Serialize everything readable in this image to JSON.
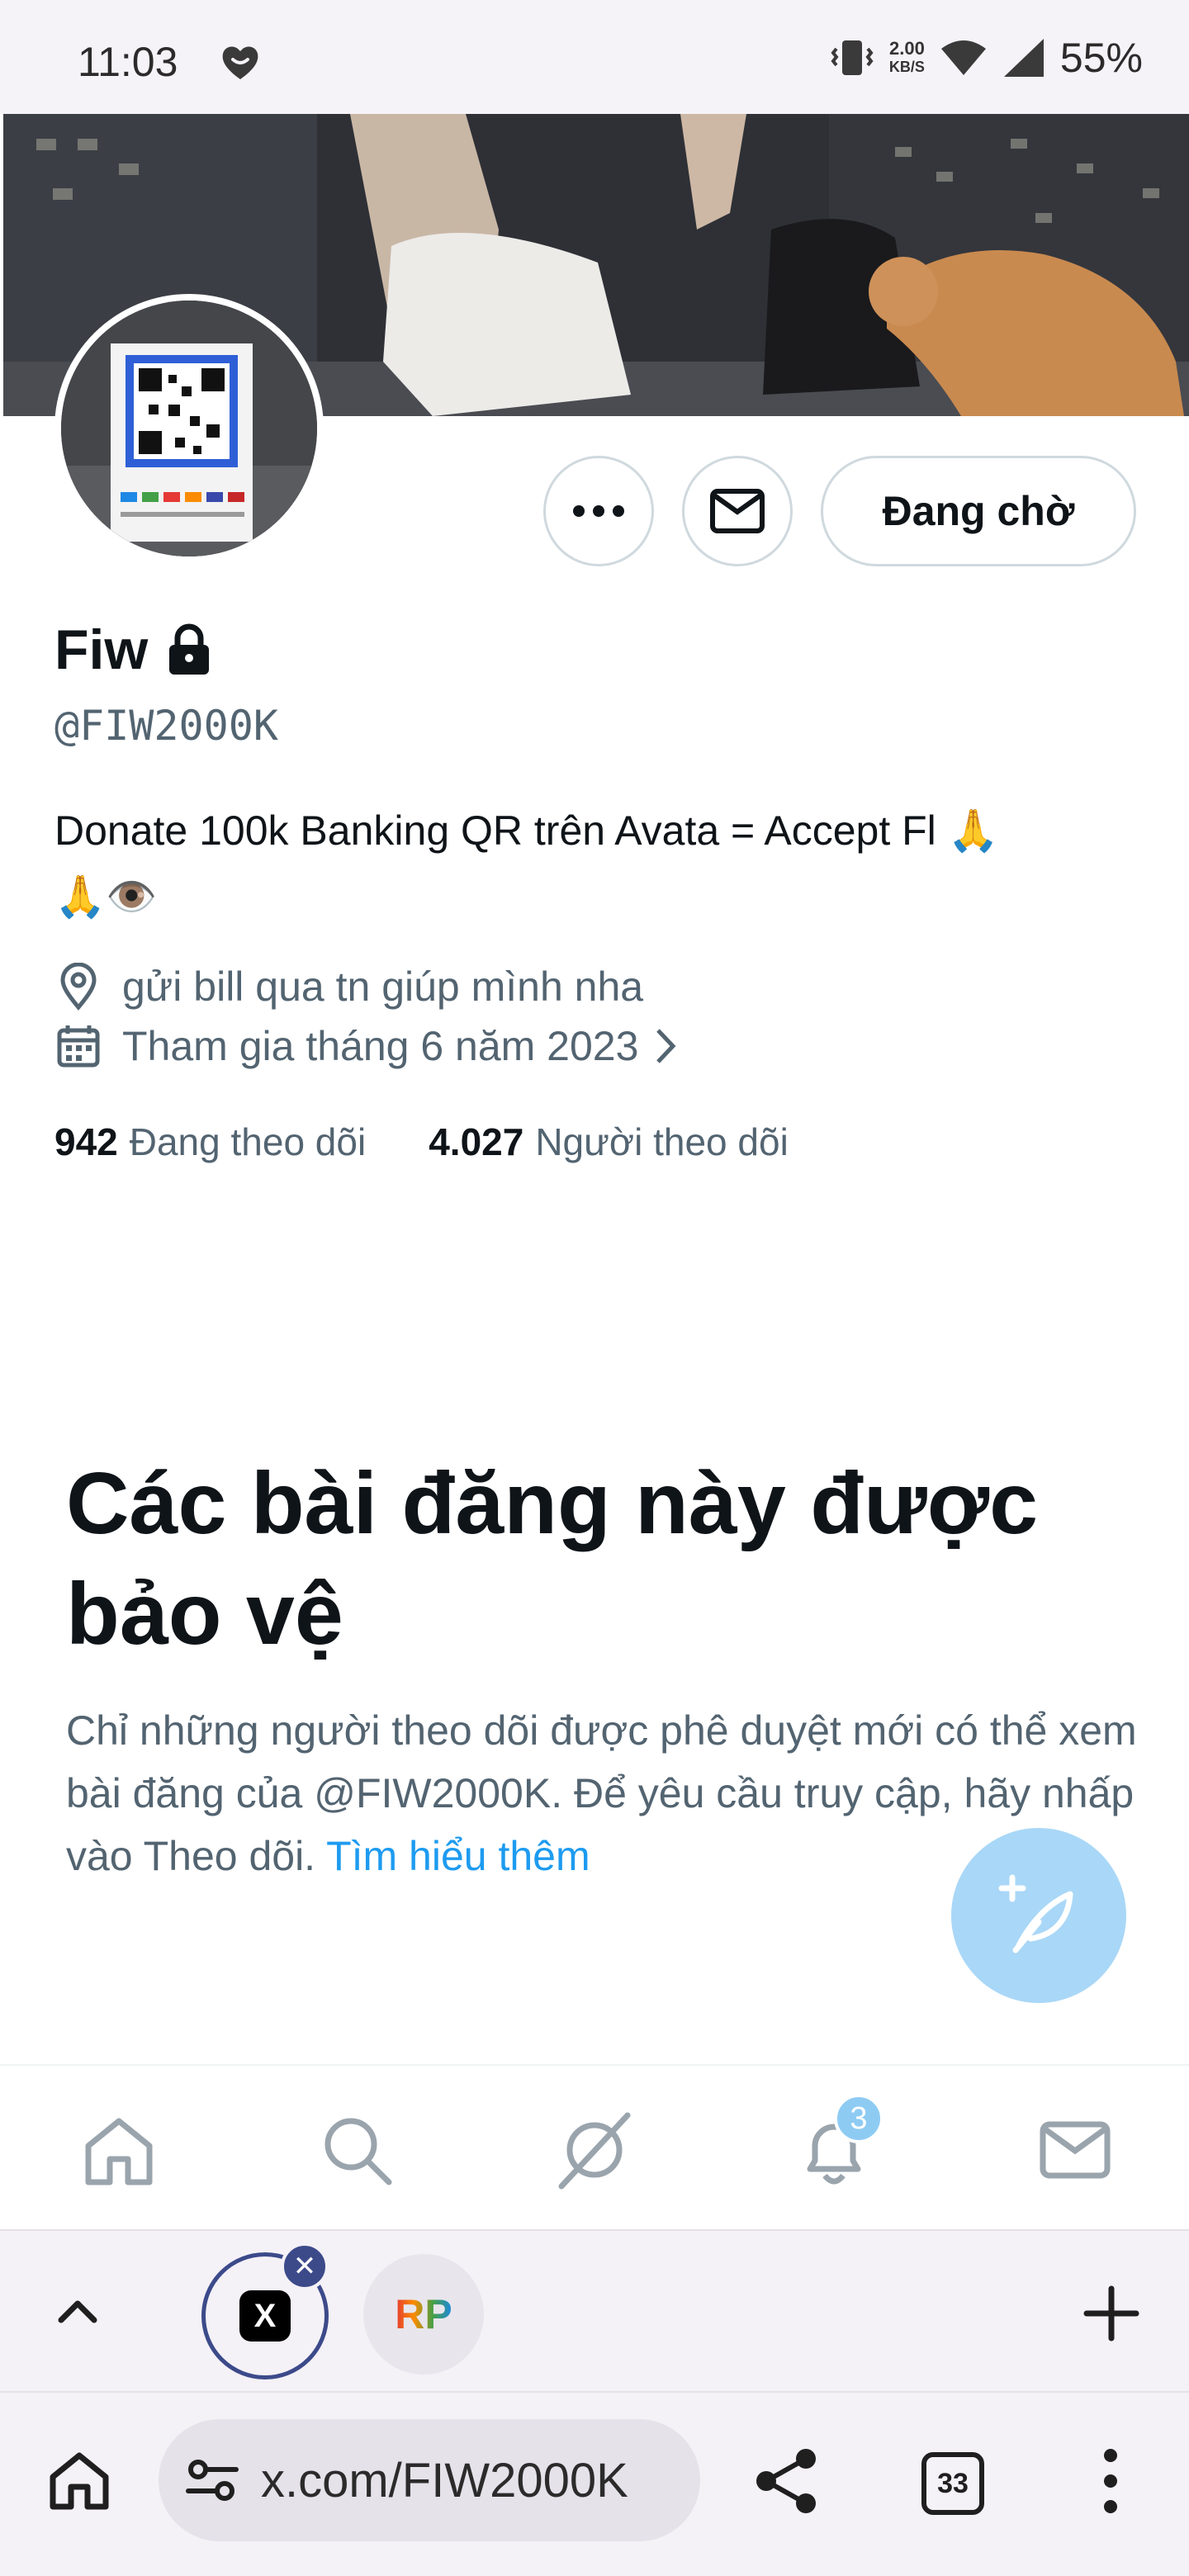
{
  "status_bar": {
    "time": "11:03",
    "net_speed_value": "2.00",
    "net_speed_unit": "KB/S",
    "battery": "55%",
    "icons": [
      "heart-shield-icon",
      "vibrate-icon",
      "wifi-icon",
      "signal-icon"
    ]
  },
  "profile": {
    "name": "Fiw",
    "handle": "@FIW2000K",
    "bio_line1": "Donate 100k Banking QR trên Avata = Accept Fl 🙏",
    "bio_line2": "🙏👁️",
    "location": "gửi bill qua tn giúp mình nha",
    "joined": "Tham gia tháng 6 năm 2023",
    "following_count": "942",
    "following_label": "Đang theo dõi",
    "followers_count": "4.027",
    "followers_label": "Người theo dõi"
  },
  "actions": {
    "pending_label": "Đang chờ"
  },
  "protected": {
    "title": "Các bài đăng này được bảo vệ",
    "description": "Chỉ những người theo dõi được phê duyệt mới có thể xem bài đăng của @FIW2000K. Để yêu cầu truy cập, hãy nhấp vào Theo dõi.",
    "learn_more": "Tìm hiểu thêm"
  },
  "bottom_nav": {
    "items": [
      "home-icon",
      "search-icon",
      "grok-icon",
      "notifications-icon",
      "messages-icon"
    ],
    "notification_badge": "3"
  },
  "browser": {
    "tabs": [
      {
        "label": "X",
        "active": true
      },
      {
        "label": "RP",
        "active": false
      }
    ],
    "url": "x.com/FIW2000K",
    "tab_count": "33"
  },
  "colors": {
    "accent": "#1d9bf0",
    "text_primary": "#0f1419",
    "text_secondary": "#536471",
    "border": "#cfd9de",
    "fab": "#a9d7f7"
  }
}
